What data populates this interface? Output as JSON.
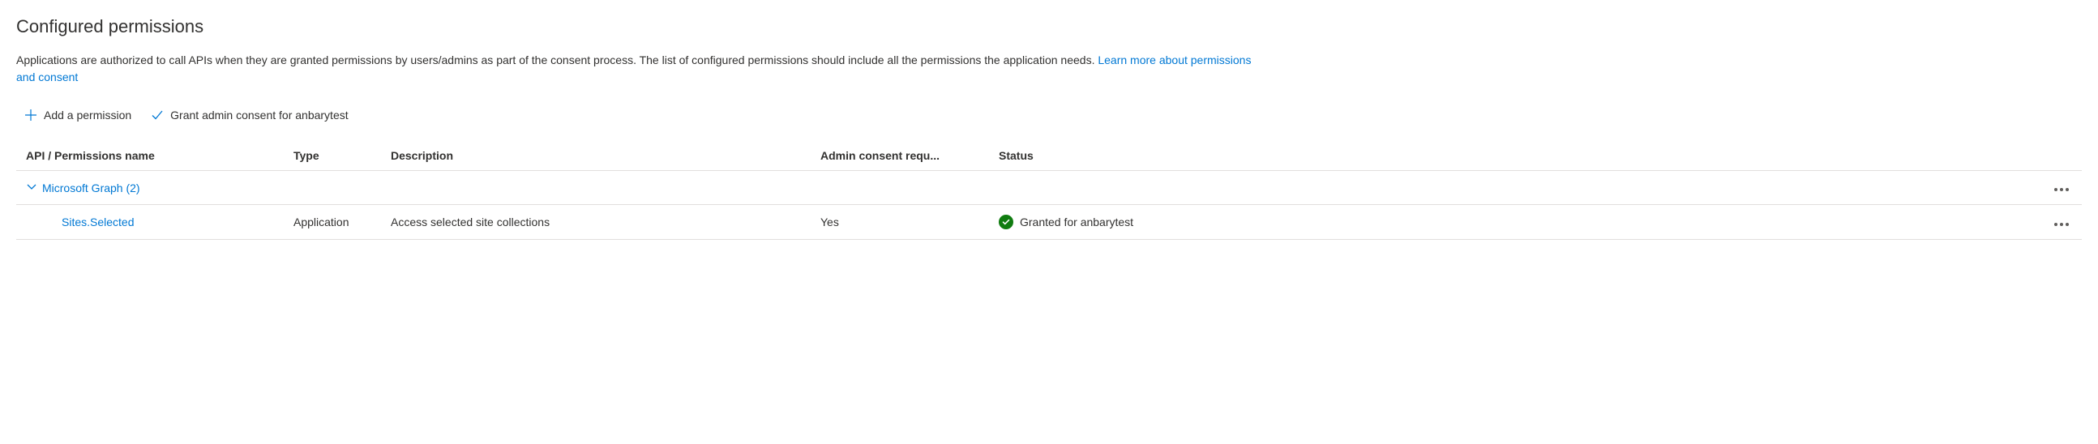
{
  "section_title": "Configured permissions",
  "description_text": "Applications are authorized to call APIs when they are granted permissions by users/admins as part of the consent process. The list of configured permissions should include all the permissions the application needs. ",
  "learn_more_label": "Learn more about permissions and consent",
  "toolbar": {
    "add_permission_label": "Add a permission",
    "grant_consent_label": "Grant admin consent for anbarytest"
  },
  "columns": {
    "api": "API / Permissions name",
    "type": "Type",
    "description": "Description",
    "admin_consent": "Admin consent requ...",
    "status": "Status"
  },
  "group": {
    "label": "Microsoft Graph (2)"
  },
  "rows": [
    {
      "name": "Sites.Selected",
      "type": "Application",
      "description": "Access selected site collections",
      "admin_consent": "Yes",
      "status": "Granted for anbarytest"
    }
  ]
}
